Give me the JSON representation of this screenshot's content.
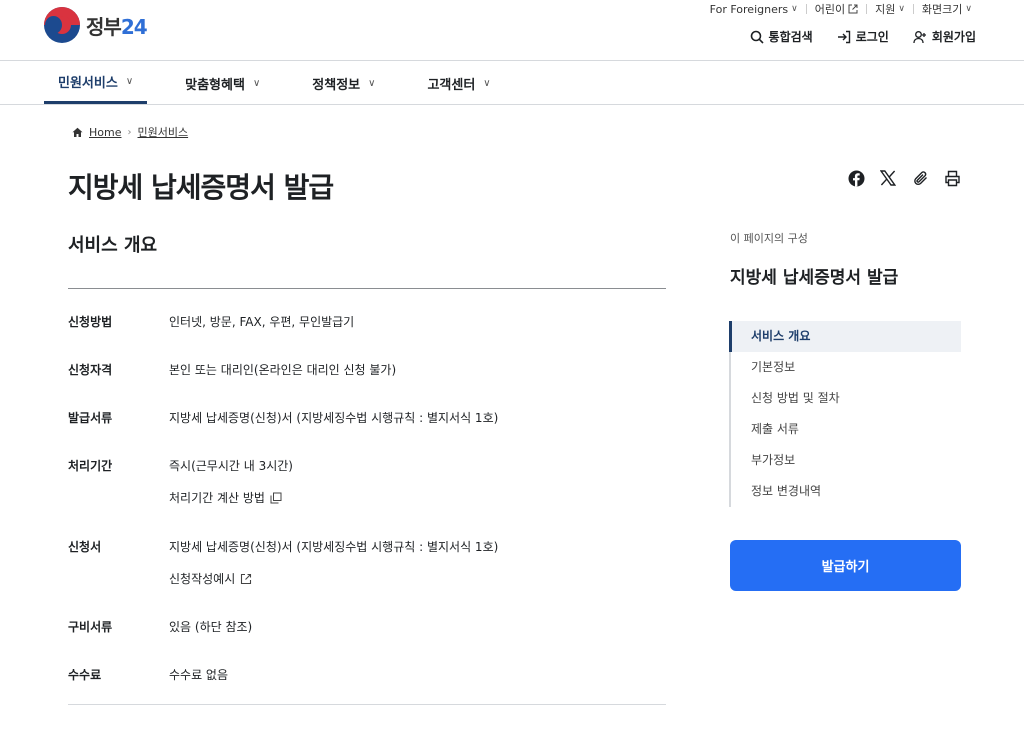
{
  "header": {
    "logo_text": "정부",
    "logo_num": "24",
    "util": [
      {
        "label": "For Foreigners",
        "icon": "chevron-down-icon"
      },
      {
        "label": "어린이",
        "icon": "external-link-icon"
      },
      {
        "label": "지원",
        "icon": "chevron-down-icon"
      },
      {
        "label": "화면크기",
        "icon": "chevron-down-icon"
      }
    ],
    "actions": {
      "search": "통합검색",
      "login": "로그인",
      "signup": "회원가입"
    }
  },
  "gnb": [
    {
      "label": "민원서비스",
      "active": true
    },
    {
      "label": "맞춤형혜택",
      "active": false
    },
    {
      "label": "정책정보",
      "active": false
    },
    {
      "label": "고객센터",
      "active": false
    }
  ],
  "breadcrumb": {
    "home": "Home",
    "current": "민원서비스"
  },
  "page_title": "지방세 납세증명서 발급",
  "section_title": "서비스 개요",
  "rows": [
    {
      "label": "신청방법",
      "value": "인터넷, 방문, FAX, 우편, 무인발급기"
    },
    {
      "label": "신청자격",
      "value": "본인 또는 대리인(온라인은 대리인 신청 불가)"
    },
    {
      "label": "발급서류",
      "value": "지방세 납세증명(신청)서 (지방세징수법 시행규칙 : 별지서식 1호)"
    },
    {
      "label": "처리기간",
      "value": "즉시(근무시간 내 3시간)",
      "link": "처리기간 계산 방법"
    },
    {
      "label": "신청서",
      "value": "지방세 납세증명(신청)서 (지방세징수법 시행규칙 : 별지서식 1호)",
      "link": "신청작성예시"
    },
    {
      "label": "구비서류",
      "value": "있음 (하단 참조)"
    },
    {
      "label": "수수료",
      "value": "수수료 없음"
    }
  ],
  "toc": {
    "caption": "이 페이지의 구성",
    "title": "지방세 납세증명서 발급",
    "items": [
      "서비스 개요",
      "기본정보",
      "신청 방법 및 절차",
      "제출 서류",
      "부가정보",
      "정보 변경내역"
    ],
    "active_index": 0
  },
  "issue_button": "발급하기",
  "colors": {
    "primary": "#256ef4",
    "nav_active": "#1e3e6b",
    "logo_red": "#d9333f",
    "logo_blue": "#1c4a8f"
  }
}
